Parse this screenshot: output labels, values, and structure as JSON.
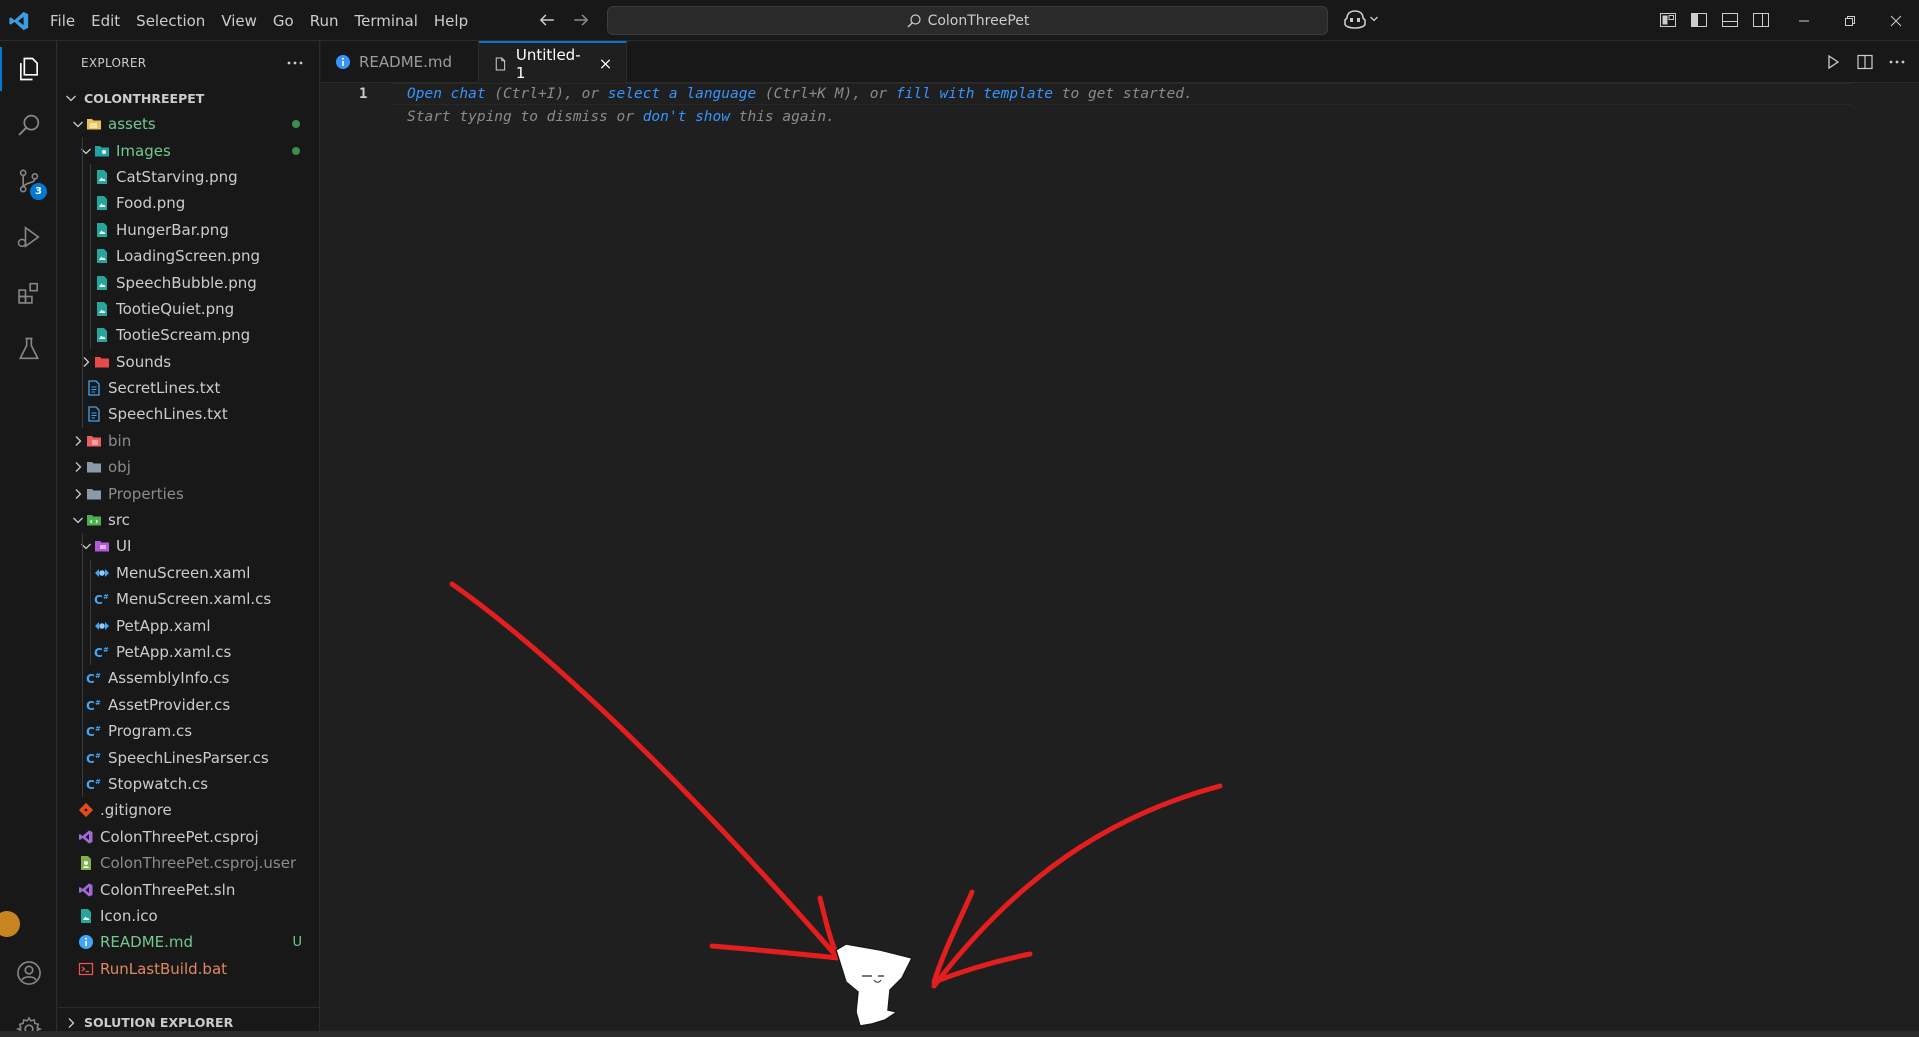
{
  "titlebar": {
    "menu": [
      "File",
      "Edit",
      "Selection",
      "View",
      "Go",
      "Run",
      "Terminal",
      "Help"
    ],
    "search_text": "ColonThreePet"
  },
  "activity": {
    "source_control_badge": "3"
  },
  "sidebar": {
    "title": "EXPLORER",
    "root": "COLONTHREEPET",
    "bottom_section": "SOLUTION EXPLORER",
    "tree": [
      {
        "label": "assets",
        "depth": 1,
        "kind": "folder-open",
        "color": "green",
        "icon": "folder-assets-icon",
        "dot": true
      },
      {
        "label": "Images",
        "depth": 2,
        "kind": "folder-open",
        "color": "green",
        "icon": "folder-images-icon",
        "dot": true
      },
      {
        "label": "CatStarving.png",
        "depth": 3,
        "kind": "file",
        "icon": "image-file-icon"
      },
      {
        "label": "Food.png",
        "depth": 3,
        "kind": "file",
        "icon": "image-file-icon"
      },
      {
        "label": "HungerBar.png",
        "depth": 3,
        "kind": "file",
        "icon": "image-file-icon"
      },
      {
        "label": "LoadingScreen.png",
        "depth": 3,
        "kind": "file",
        "icon": "image-file-icon"
      },
      {
        "label": "SpeechBubble.png",
        "depth": 3,
        "kind": "file",
        "icon": "image-file-icon"
      },
      {
        "label": "TootieQuiet.png",
        "depth": 3,
        "kind": "file",
        "icon": "image-file-icon"
      },
      {
        "label": "TootieScream.png",
        "depth": 3,
        "kind": "file",
        "icon": "image-file-icon"
      },
      {
        "label": "Sounds",
        "depth": 2,
        "kind": "folder-closed",
        "icon": "folder-sounds-icon"
      },
      {
        "label": "SecretLines.txt",
        "depth": 2,
        "kind": "file",
        "icon": "text-file-icon"
      },
      {
        "label": "SpeechLines.txt",
        "depth": 2,
        "kind": "file",
        "icon": "text-file-icon"
      },
      {
        "label": "bin",
        "depth": 1,
        "kind": "folder-closed",
        "color": "dim",
        "icon": "folder-bin-icon"
      },
      {
        "label": "obj",
        "depth": 1,
        "kind": "folder-closed",
        "color": "dim",
        "icon": "folder-icon"
      },
      {
        "label": "Properties",
        "depth": 1,
        "kind": "folder-closed",
        "color": "dim",
        "icon": "folder-icon"
      },
      {
        "label": "src",
        "depth": 1,
        "kind": "folder-open",
        "icon": "folder-src-icon"
      },
      {
        "label": "UI",
        "depth": 2,
        "kind": "folder-open",
        "icon": "folder-ui-icon"
      },
      {
        "label": "MenuScreen.xaml",
        "depth": 3,
        "kind": "file",
        "icon": "xaml-file-icon"
      },
      {
        "label": "MenuScreen.xaml.cs",
        "depth": 3,
        "kind": "file",
        "icon": "csharp-file-icon"
      },
      {
        "label": "PetApp.xaml",
        "depth": 3,
        "kind": "file",
        "icon": "xaml-file-icon"
      },
      {
        "label": "PetApp.xaml.cs",
        "depth": 3,
        "kind": "file",
        "icon": "csharp-file-icon"
      },
      {
        "label": "AssemblyInfo.cs",
        "depth": 2,
        "kind": "file",
        "icon": "csharp-file-icon"
      },
      {
        "label": "AssetProvider.cs",
        "depth": 2,
        "kind": "file",
        "icon": "csharp-file-icon"
      },
      {
        "label": "Program.cs",
        "depth": 2,
        "kind": "file",
        "icon": "csharp-file-icon"
      },
      {
        "label": "SpeechLinesParser.cs",
        "depth": 2,
        "kind": "file",
        "icon": "csharp-file-icon"
      },
      {
        "label": "Stopwatch.cs",
        "depth": 2,
        "kind": "file",
        "icon": "csharp-file-icon"
      },
      {
        "label": ".gitignore",
        "depth": 1,
        "kind": "file",
        "icon": "git-file-icon"
      },
      {
        "label": "ColonThreePet.csproj",
        "depth": 1,
        "kind": "file",
        "icon": "visualstudio-file-icon"
      },
      {
        "label": "ColonThreePet.csproj.user",
        "depth": 1,
        "kind": "file",
        "color": "dim",
        "icon": "user-file-icon"
      },
      {
        "label": "ColonThreePet.sln",
        "depth": 1,
        "kind": "file",
        "icon": "visualstudio-file-icon"
      },
      {
        "label": "Icon.ico",
        "depth": 1,
        "kind": "file",
        "icon": "image-file-icon"
      },
      {
        "label": "README.md",
        "depth": 1,
        "kind": "file",
        "color": "green",
        "icon": "info-file-icon",
        "status": "U"
      },
      {
        "label": "RunLastBuild.bat",
        "depth": 1,
        "kind": "file",
        "color": "orange",
        "icon": "bat-file-icon"
      }
    ]
  },
  "tabs": [
    {
      "label": "README.md",
      "active": false
    },
    {
      "label": "Untitled-1",
      "active": true
    }
  ],
  "editor": {
    "line_number": "1",
    "hint1": {
      "open_chat": "Open chat",
      "t1": " (Ctrl+I), or ",
      "select_language": "select a language",
      "t2": " (Ctrl+K M), or ",
      "fill_template": "fill with template",
      "t3": " to get started."
    },
    "hint2": {
      "t1": "Start typing to dismiss or ",
      "dont_show": "don't show",
      "t2": " this again."
    }
  }
}
